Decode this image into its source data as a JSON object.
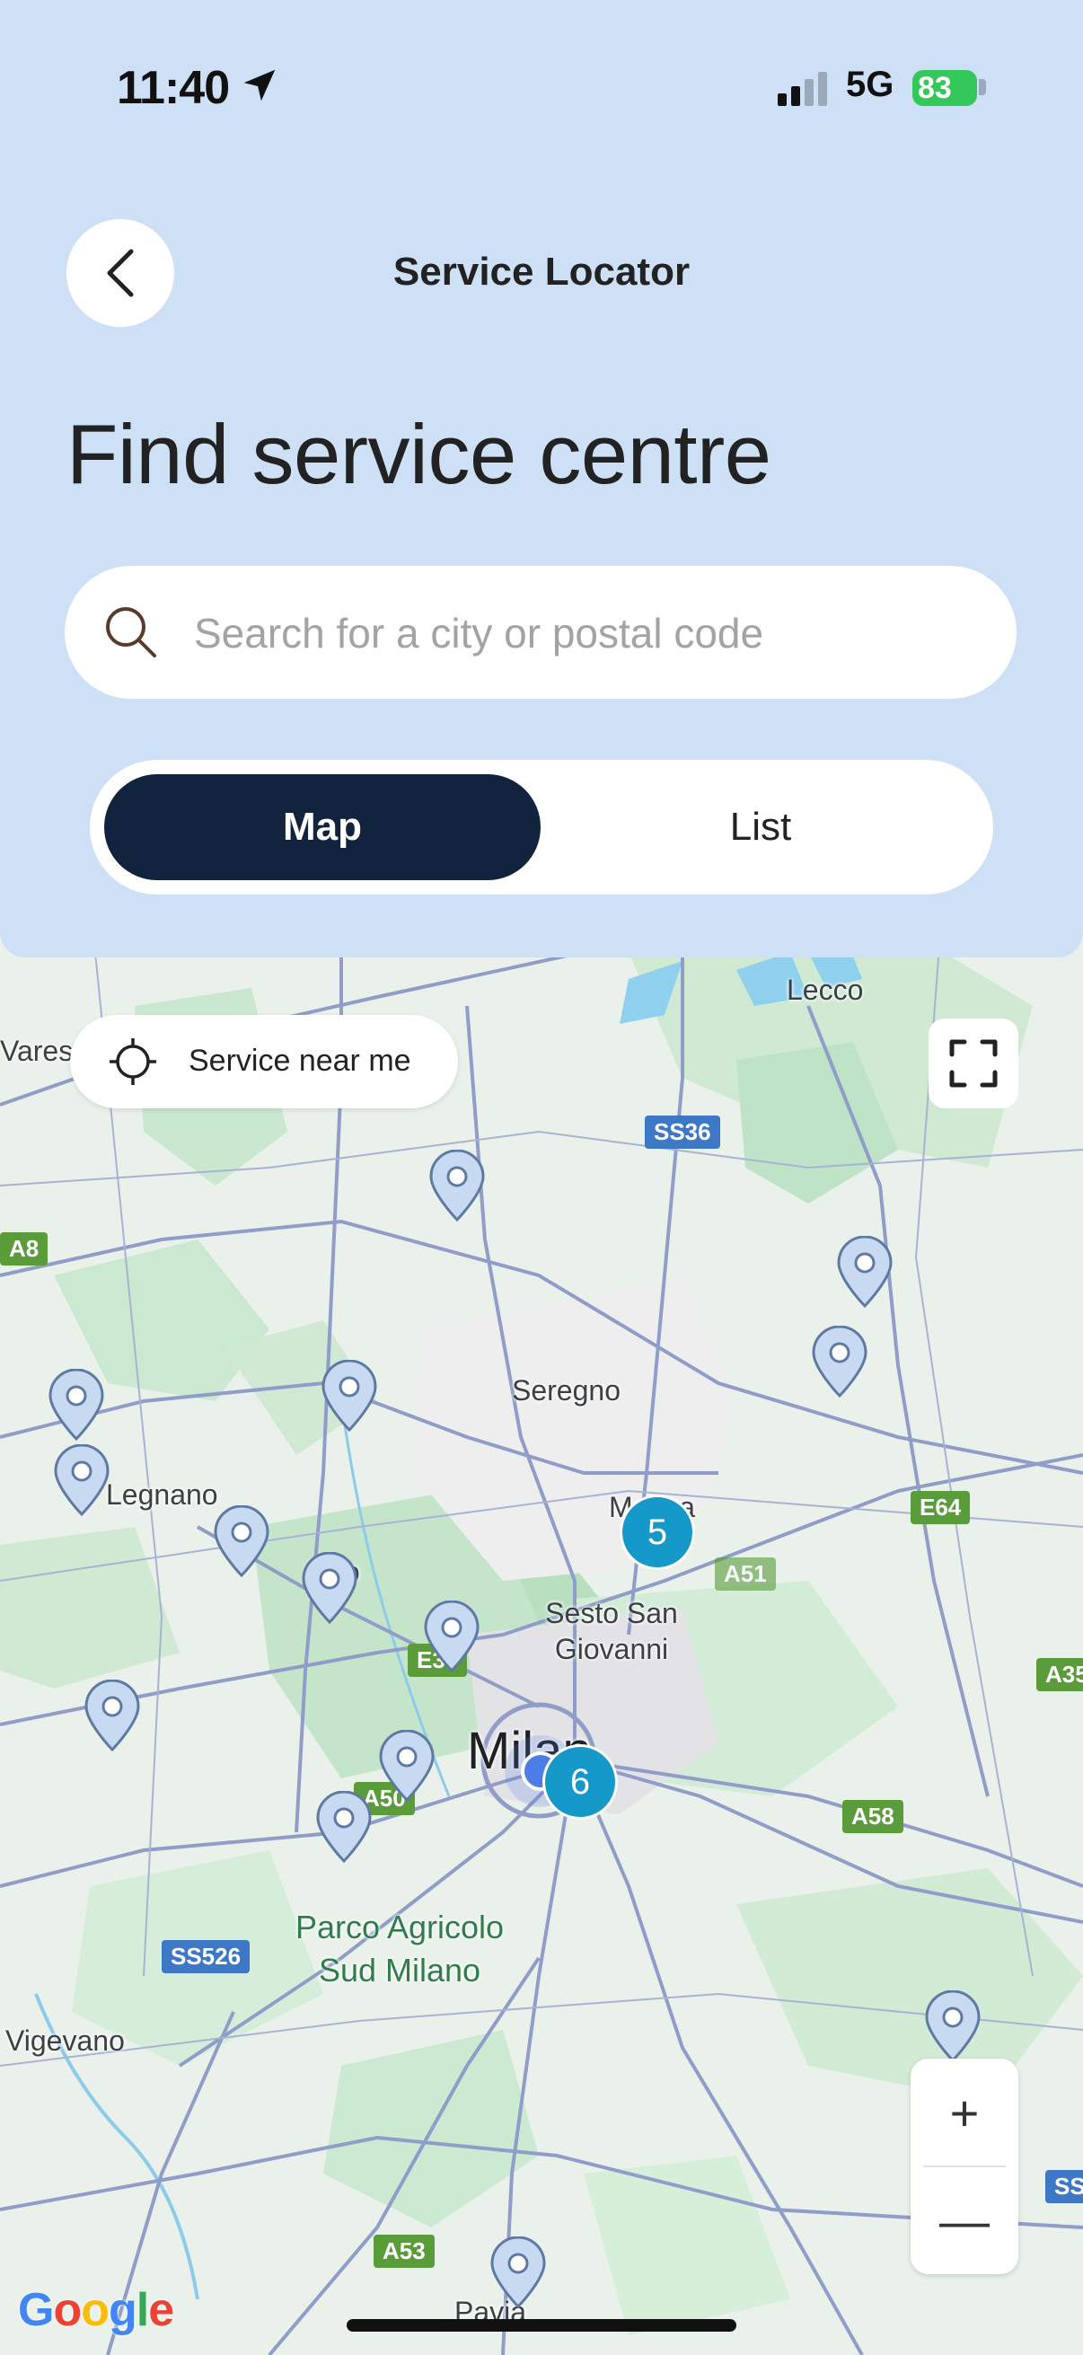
{
  "status_bar": {
    "time": "11:40",
    "network": "5G",
    "battery": "83"
  },
  "nav": {
    "title": "Service Locator"
  },
  "page": {
    "title": "Find service centre"
  },
  "search": {
    "placeholder": "Search for a city or postal code",
    "value": ""
  },
  "view_toggle": {
    "options": [
      {
        "label": "Map",
        "active": true
      },
      {
        "label": "List",
        "active": false
      }
    ]
  },
  "map": {
    "service_near_me_label": "Service near me",
    "place_labels": [
      "Lecco",
      "Seregno",
      "Legnano",
      "Monza",
      "Rho",
      "Sesto San Giovanni",
      "Milan",
      "Parco Agricolo Sud Milano",
      "Vigevano",
      "Pavia",
      "Varese"
    ],
    "road_labels": [
      "SS36",
      "A8",
      "E64",
      "A51",
      "E35",
      "A35",
      "A50",
      "A58",
      "SS526",
      "A53",
      "SS"
    ],
    "clusters": [
      "5",
      "6"
    ],
    "zoom_in_label": "+",
    "zoom_out_label": "—",
    "attribution": "Google"
  },
  "colors": {
    "header_bg": "#cde0f6",
    "toggle_active": "#12233d",
    "cluster": "#1499c8",
    "battery": "#34c759"
  }
}
